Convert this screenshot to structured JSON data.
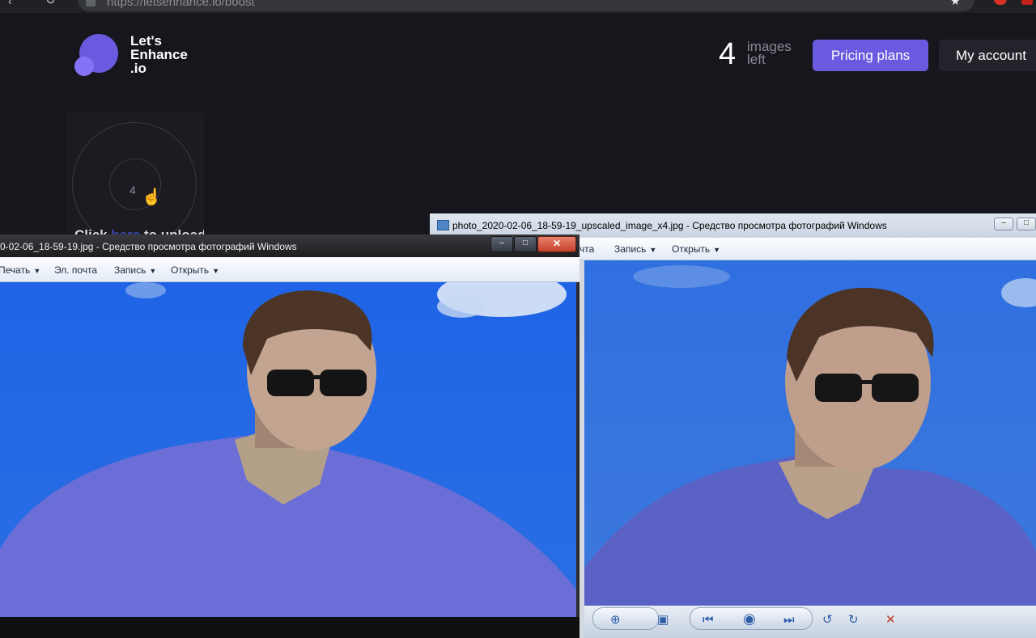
{
  "browser": {
    "url": "https://letsenhance.io/boost",
    "icons": [
      "back-icon",
      "reload-icon",
      "lock-icon",
      "star-icon",
      "extension-icon"
    ]
  },
  "site": {
    "logo_lines": [
      "Let's",
      "Enhance",
      ".io"
    ],
    "images_left": {
      "count": "4",
      "line1": "images",
      "line2": "left"
    },
    "pricing_button": "Pricing plans",
    "account_button": "My account",
    "upload": {
      "count": "4",
      "prefix": "Click ",
      "link": "here",
      "suffix": " to upload"
    },
    "colors": {
      "brand": "#6a5ae0",
      "background": "#17161c"
    }
  },
  "viewer_left": {
    "title": "0-02-06_18-59-19.jpg - Средство просмотра фотографий Windows",
    "menu": [
      "Печать",
      "Эл. почта",
      "Запись",
      "Открыть"
    ],
    "buttons": {
      "minimize": "–",
      "maximize": "□",
      "close": "✕"
    },
    "help": "?"
  },
  "viewer_right": {
    "title": "photo_2020-02-06_18-59-19_upscaled_image_x4.jpg - Средство просмотра фотографий Windows",
    "menu": [
      "чта",
      "Запись",
      "Открыть"
    ],
    "buttons": {
      "minimize": "–",
      "maximize": "□"
    },
    "toolbar_icons": [
      "zoom-icon",
      "fit-window-icon",
      "previous-icon",
      "slideshow-icon",
      "next-icon",
      "rotate-left-icon",
      "rotate-right-icon",
      "delete-icon"
    ]
  }
}
